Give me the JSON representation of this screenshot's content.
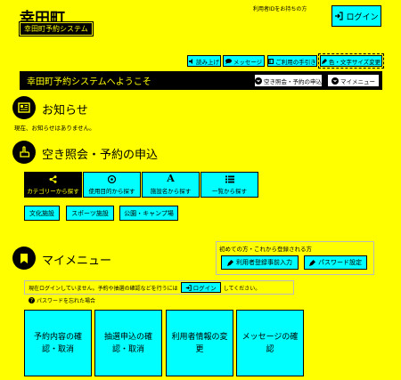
{
  "header": {
    "town_name": "幸田町",
    "system_name": "幸田町予約システム",
    "help_text": "利用者IDをお持ちの方",
    "login_label": "ログイン"
  },
  "toolbar": {
    "items": [
      {
        "label": "読み上げ",
        "icon": "speaker-icon"
      },
      {
        "label": "メッセージ",
        "icon": "message-icon"
      },
      {
        "label": "ご利用の手引き",
        "icon": "book-icon"
      },
      {
        "label": "色・文字サイズ変更",
        "icon": "pen-icon"
      }
    ]
  },
  "welcome": {
    "text": "幸田町予約システムへようこそ",
    "availability_button": "空き照会・予約の申込",
    "mymenu_button": "マイメニュー"
  },
  "notices": {
    "title": "お知らせ",
    "body": "現在、お知らせはありません。"
  },
  "search": {
    "title": "空き照会・予約の申込",
    "tabs": [
      {
        "label": "カテゴリーから探す",
        "icon": "share-icon",
        "selected": true
      },
      {
        "label": "使用目的から探す",
        "icon": "target-icon",
        "selected": false
      },
      {
        "label": "施設名から探す",
        "icon": "letter-a-icon",
        "selected": false
      },
      {
        "label": "一覧から探す",
        "icon": "list-icon",
        "selected": false
      }
    ],
    "categories": [
      "文化施設",
      "スポーツ施設",
      "公園・キャンプ場"
    ]
  },
  "mymenu": {
    "title": "マイメニュー",
    "first_time_text": "初めての方・これから登録される方",
    "register_button": "利用者登録事前入力",
    "password_button": "パスワード設定",
    "notice_before": "現在ログインしていません。予約や抽選の確認などを行うには",
    "notice_login": "ログイン",
    "notice_after": "してください。",
    "forgot_password": "パスワードを忘れた場合",
    "big_buttons": [
      "予約内容の確認・取消",
      "抽選申込の確認・取消",
      "利用者情報の変更",
      "メッセージの確認"
    ]
  },
  "colors": {
    "background": "#ffff00",
    "accent": "#00ffff",
    "dark": "#000000"
  }
}
